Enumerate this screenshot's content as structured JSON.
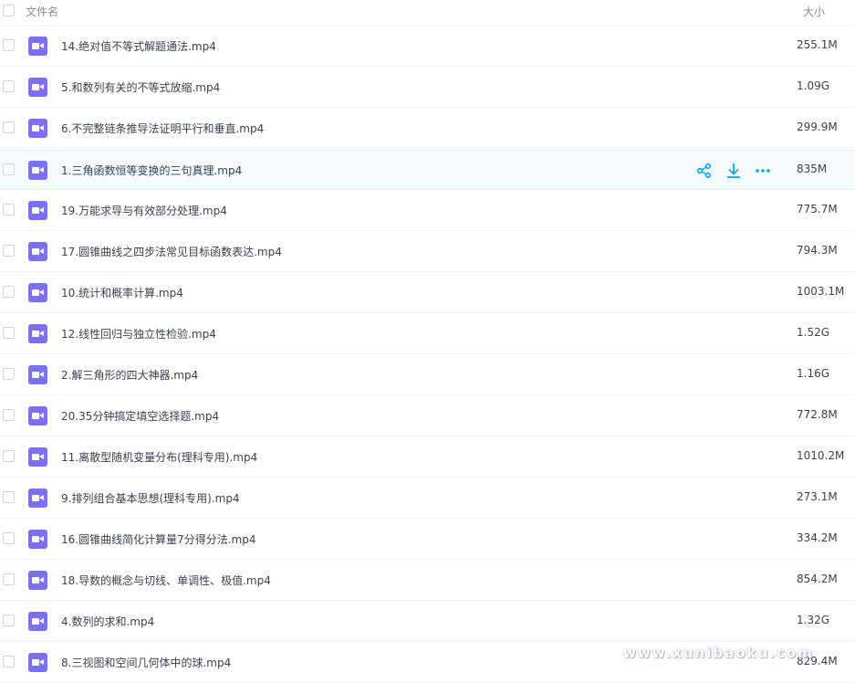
{
  "header": {
    "name_label": "文件名",
    "size_label": "大小"
  },
  "files": [
    {
      "name": "14.绝对值不等式解题通法.mp4",
      "size": "255.1M"
    },
    {
      "name": "5.和数列有关的不等式放缩.mp4",
      "size": "1.09G"
    },
    {
      "name": "6.不完整链条推导法证明平行和垂直.mp4",
      "size": "299.9M"
    },
    {
      "name": "1.三角函数恒等变换的三句真理.mp4",
      "size": "835M"
    },
    {
      "name": "19.万能求导与有效部分处理.mp4",
      "size": "775.7M"
    },
    {
      "name": "17.圆锥曲线之四步法常见目标函数表达.mp4",
      "size": "794.3M"
    },
    {
      "name": "10.统计和概率计算.mp4",
      "size": "1003.1M"
    },
    {
      "name": "12.线性回归与独立性检验.mp4",
      "size": "1.52G"
    },
    {
      "name": "2.解三角形的四大神器.mp4",
      "size": "1.16G"
    },
    {
      "name": "20.35分钟搞定填空选择题.mp4",
      "size": "772.8M"
    },
    {
      "name": "11.离散型随机变量分布(理科专用).mp4",
      "size": "1010.2M"
    },
    {
      "name": "9.排列组合基本思想(理科专用).mp4",
      "size": "273.1M"
    },
    {
      "name": "16.圆锥曲线简化计算量7分得分法.mp4",
      "size": "334.2M"
    },
    {
      "name": "18.导数的概念与切线、单调性、极值.mp4",
      "size": "854.2M"
    },
    {
      "name": "4.数列的求和.mp4",
      "size": "1.32G"
    },
    {
      "name": "8.三视图和空间几何体中的球.mp4",
      "size": "829.4M"
    }
  ],
  "hover_row_index": 3,
  "row_actions": {
    "share_icon": "share-icon",
    "download_icon": "download-icon",
    "more_icon": "more-icon"
  },
  "watermark": "www.xunibaoku.com",
  "colors": {
    "accent": "#06a7ff",
    "file_icon": "#7d6ff3",
    "hover_bg": "#f5faff"
  }
}
